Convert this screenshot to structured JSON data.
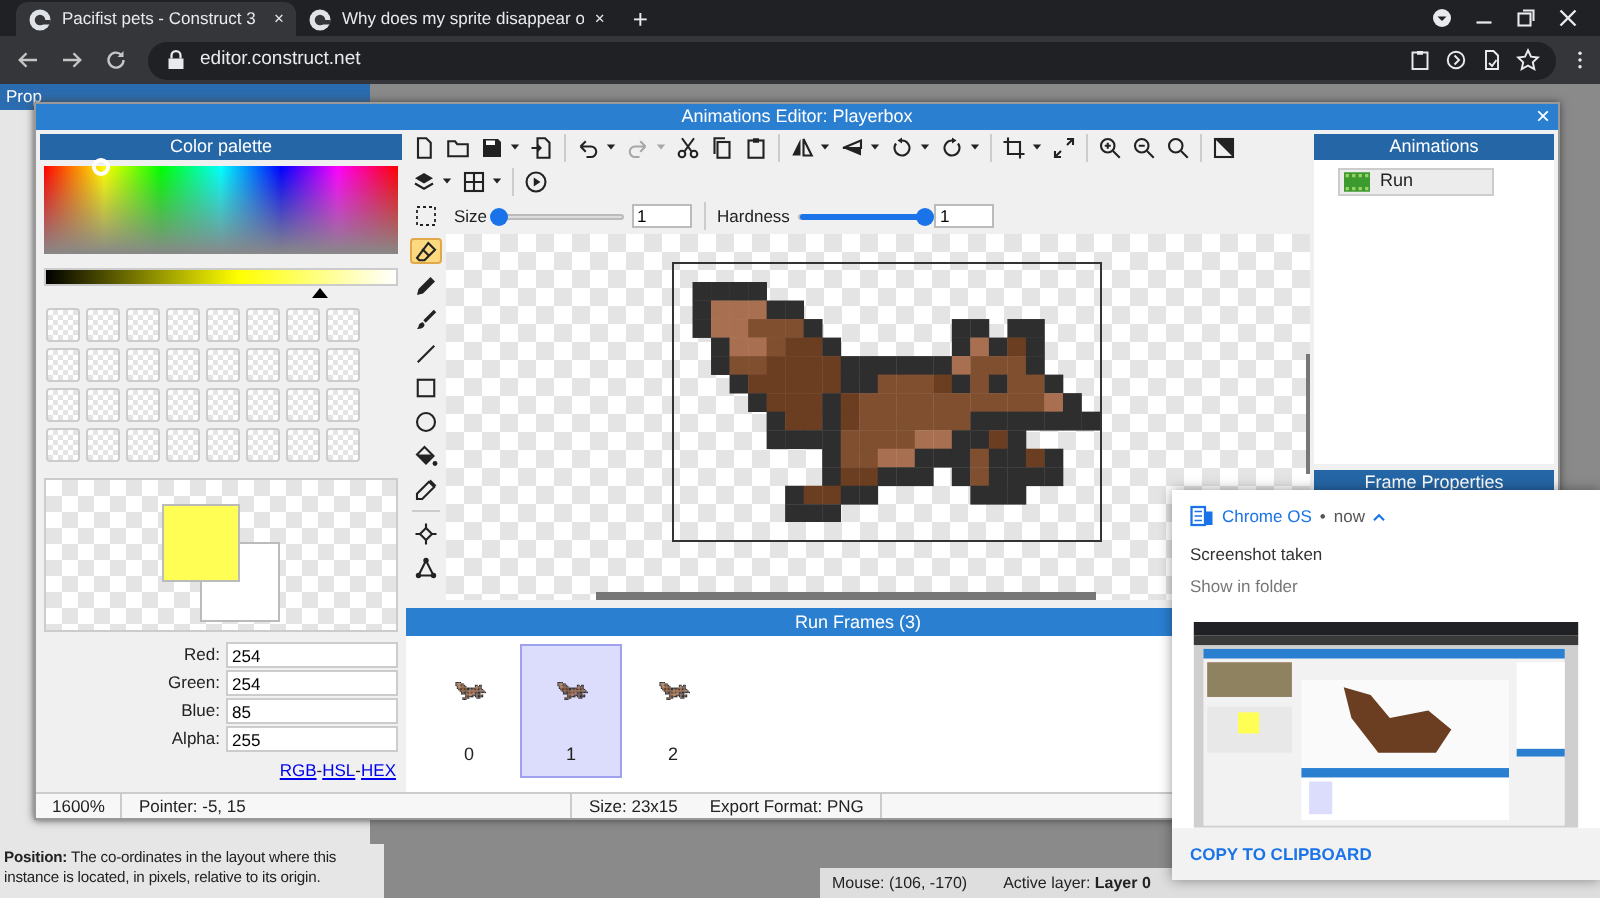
{
  "browser": {
    "tabs": [
      {
        "title": "Pacifist pets - Construct 3",
        "close": "×",
        "selected": true
      },
      {
        "title": "Why does my sprite disappear o",
        "close": "×",
        "selected": false
      }
    ],
    "new_tab": "+",
    "url": "editor.construct.net"
  },
  "editor": {
    "panel_title": "Prop",
    "help_text": "**Position:** The co-ordinates in the layout where this instance is located, in pixels, relative to its origin.",
    "status": [
      "Mouse: (106, -170)",
      "Active layer: **Layer 0**"
    ]
  },
  "dialog": {
    "title": "Animations Editor: Playerbox",
    "close": "×",
    "palette": {
      "title": "Color palette",
      "picker": {
        "level": 0.16
      },
      "brightness": {
        "level": 0.78
      },
      "fields": [
        {
          "label": "Red:",
          "value": "254"
        },
        {
          "label": "Green:",
          "value": "254"
        },
        {
          "label": "Blue:",
          "value": "85"
        },
        {
          "label": "Alpha:",
          "value": "255"
        }
      ],
      "links": [
        "RGB",
        "HSL",
        "HEX"
      ],
      "separator": "-"
    },
    "toolbar": [
      [
        {
          "kind": "new",
          "caret": false,
          "disabled": false
        },
        {
          "kind": "open",
          "caret": false,
          "disabled": false
        },
        {
          "kind": "save",
          "caret": true,
          "disabled": false
        },
        {
          "kind": "import",
          "caret": false,
          "disabled": false
        },
        {
          "kind": "sep"
        },
        {
          "kind": "undo",
          "caret": true,
          "disabled": false
        },
        {
          "kind": "redo",
          "caret": true,
          "disabled": true
        },
        {
          "kind": "cut",
          "caret": false,
          "disabled": false
        },
        {
          "kind": "copy",
          "caret": false,
          "disabled": false
        },
        {
          "kind": "paste",
          "caret": false,
          "disabled": false
        },
        {
          "kind": "sep"
        },
        {
          "kind": "mirror",
          "caret": true,
          "disabled": false
        },
        {
          "kind": "flip",
          "caret": true,
          "disabled": false
        },
        {
          "kind": "rotate-left",
          "caret": true,
          "disabled": false
        },
        {
          "kind": "rotate-right",
          "caret": true,
          "disabled": false
        },
        {
          "kind": "sep"
        },
        {
          "kind": "crop",
          "caret": true,
          "disabled": false
        },
        {
          "kind": "resize",
          "caret": false,
          "disabled": false
        },
        {
          "kind": "sep"
        },
        {
          "kind": "zoom-in",
          "caret": false,
          "disabled": false
        },
        {
          "kind": "zoom-out",
          "caret": false,
          "disabled": false
        },
        {
          "kind": "zoom-reset",
          "caret": false,
          "disabled": false
        },
        {
          "kind": "sep"
        },
        {
          "kind": "background",
          "caret": false,
          "disabled": false
        }
      ],
      [
        {
          "kind": "layers",
          "caret": true,
          "disabled": false
        },
        {
          "kind": "grid",
          "caret": true,
          "disabled": false
        },
        {
          "kind": "sep"
        },
        {
          "kind": "play",
          "caret": false,
          "disabled": false
        }
      ]
    ],
    "brush": {
      "size": {
        "label": "Size",
        "level": 0.0,
        "value": "1"
      },
      "hardness": {
        "label": "Hardness",
        "level": 1.0,
        "value": "1"
      }
    },
    "tools": [
      {
        "kind": "eraser",
        "selected": true
      },
      {
        "kind": "pencil",
        "selected": false
      },
      {
        "kind": "brush",
        "selected": false
      },
      {
        "kind": "line",
        "selected": false
      },
      {
        "kind": "rectangle",
        "selected": false
      },
      {
        "kind": "ellipse",
        "selected": false
      },
      {
        "kind": "fill",
        "selected": false
      },
      {
        "kind": "picker",
        "selected": false
      },
      {
        "kind": "sep"
      },
      {
        "kind": "origin",
        "selected": false
      },
      {
        "kind": "polygon",
        "selected": false
      }
    ],
    "frames": {
      "title": "Run Frames (3)",
      "items": [
        {
          "label": "0",
          "selected": false
        },
        {
          "label": "1",
          "selected": true
        },
        {
          "label": "2",
          "selected": false
        }
      ]
    },
    "status": [
      "1600%",
      "Pointer: -5, 15",
      "Size: 23x15",
      "Export Format: PNG"
    ],
    "animations": {
      "title": "Animations",
      "items": [
        {
          "name": "Run",
          "selected": false
        }
      ]
    },
    "frame_properties": {
      "title": "Frame Properties"
    }
  },
  "notification": {
    "source": "Chrome OS",
    "separator": "•",
    "time": "now",
    "title": "Screenshot taken",
    "subtitle": "Show in folder",
    "action": "COPY TO CLIPBOARD"
  }
}
